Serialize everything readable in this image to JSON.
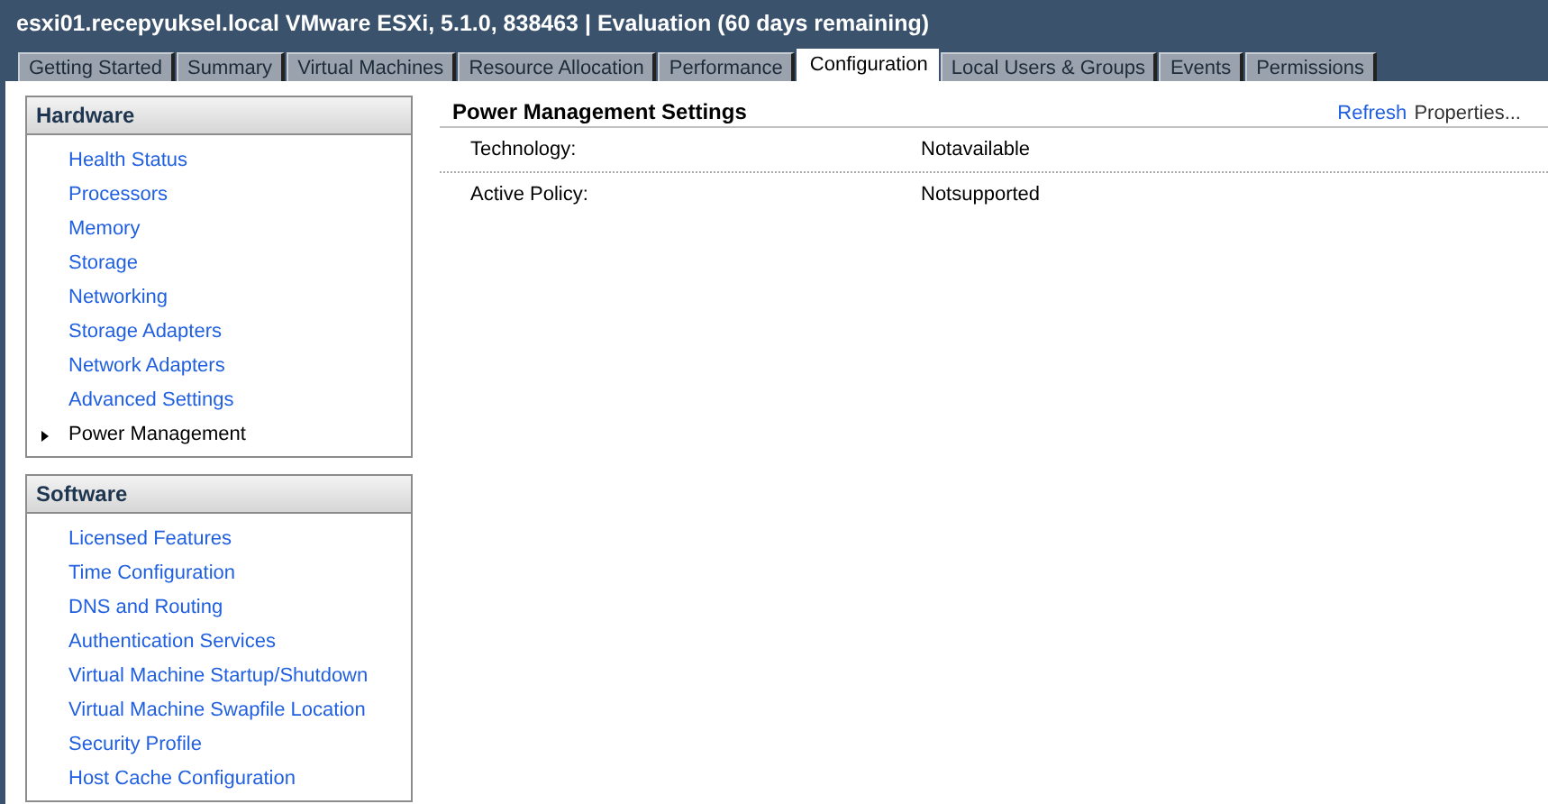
{
  "window": {
    "title": "esxi01.recepyuksel.local VMware ESXi, 5.1.0, 838463 | Evaluation (60 days remaining)"
  },
  "tabs": [
    {
      "label": "Getting Started",
      "selected": false
    },
    {
      "label": "Summary",
      "selected": false
    },
    {
      "label": "Virtual Machines",
      "selected": false
    },
    {
      "label": "Resource Allocation",
      "selected": false
    },
    {
      "label": "Performance",
      "selected": false
    },
    {
      "label": "Configuration",
      "selected": true
    },
    {
      "label": "Local Users & Groups",
      "selected": false
    },
    {
      "label": "Events",
      "selected": false
    },
    {
      "label": "Permissions",
      "selected": false
    }
  ],
  "sidebar": {
    "sections": [
      {
        "title": "Hardware",
        "items": [
          {
            "label": "Health Status",
            "selected": false
          },
          {
            "label": "Processors",
            "selected": false
          },
          {
            "label": "Memory",
            "selected": false
          },
          {
            "label": "Storage",
            "selected": false
          },
          {
            "label": "Networking",
            "selected": false
          },
          {
            "label": "Storage Adapters",
            "selected": false
          },
          {
            "label": "Network Adapters",
            "selected": false
          },
          {
            "label": "Advanced Settings",
            "selected": false
          },
          {
            "label": "Power Management",
            "selected": true
          }
        ]
      },
      {
        "title": "Software",
        "items": [
          {
            "label": "Licensed Features",
            "selected": false
          },
          {
            "label": "Time Configuration",
            "selected": false
          },
          {
            "label": "DNS and Routing",
            "selected": false
          },
          {
            "label": "Authentication Services",
            "selected": false
          },
          {
            "label": "Virtual Machine Startup/Shutdown",
            "selected": false
          },
          {
            "label": "Virtual Machine Swapfile Location",
            "selected": false
          },
          {
            "label": "Security Profile",
            "selected": false
          },
          {
            "label": "Host Cache Configuration",
            "selected": false
          }
        ]
      }
    ]
  },
  "content": {
    "title": "Power Management Settings",
    "links": [
      "Refresh",
      "Properties..."
    ],
    "rows": [
      {
        "label": "Technology:",
        "value": "Notavailable"
      },
      {
        "label": "Active Policy:",
        "value": "Notsupported"
      }
    ]
  }
}
